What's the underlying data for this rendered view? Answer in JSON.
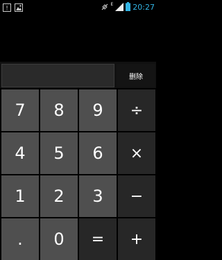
{
  "status_bar": {
    "time": "20:27",
    "network_type": "E",
    "icons": [
      "warning-icon",
      "image-icon",
      "signal-muted-icon",
      "signal-icon",
      "battery-icon"
    ]
  },
  "display": {
    "value": "",
    "delete_label": "删除"
  },
  "keypad": {
    "row1": [
      "7",
      "8",
      "9",
      "÷"
    ],
    "row2": [
      "4",
      "5",
      "6",
      "×"
    ],
    "row3": [
      "1",
      "2",
      "3",
      "−"
    ],
    "row4": [
      ".",
      "0",
      "=",
      "+"
    ]
  },
  "colors": {
    "digit_key": "#4f4f4f",
    "operator_key": "#272727",
    "time_accent": "#33b5e5",
    "background": "#000000"
  }
}
